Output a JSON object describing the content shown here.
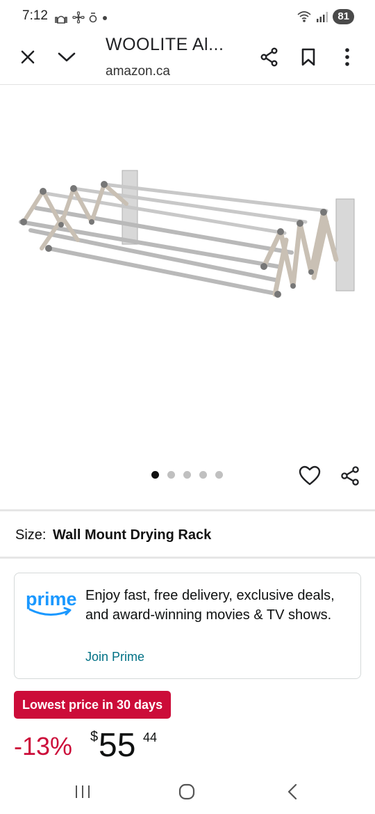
{
  "status_bar": {
    "time": "7:12",
    "left_icons": [
      "mosque-icon",
      "fan-icon",
      "person-icon",
      "dot-icon"
    ],
    "right_icons": [
      "wifi-icon",
      "signal-icon"
    ],
    "battery": "81"
  },
  "toolbar": {
    "title": "WOOLITE Al...",
    "url": "amazon.ca",
    "icons": [
      "close-icon",
      "chevron-down-icon",
      "share-icon",
      "bookmark-icon",
      "more-vert-icon"
    ]
  },
  "product": {
    "image_subject": "wall-mounted accordion drying rack",
    "image_count": 5,
    "active_image": 0
  },
  "size": {
    "label": "Size:",
    "value": "Wall Mount Drying Rack"
  },
  "prime": {
    "logo_text": "prime",
    "message": "Enjoy fast, free delivery, exclusive deals, and award-winning movies & TV shows.",
    "join_label": "Join Prime"
  },
  "deal": {
    "badge": "Lowest price in 30 days"
  },
  "price": {
    "discount": "-13%",
    "currency": "$",
    "whole": "55",
    "fraction": "44"
  },
  "colors": {
    "deal_red": "#cc0c39",
    "prime_blue": "#1a98ff",
    "link_teal": "#007185"
  }
}
